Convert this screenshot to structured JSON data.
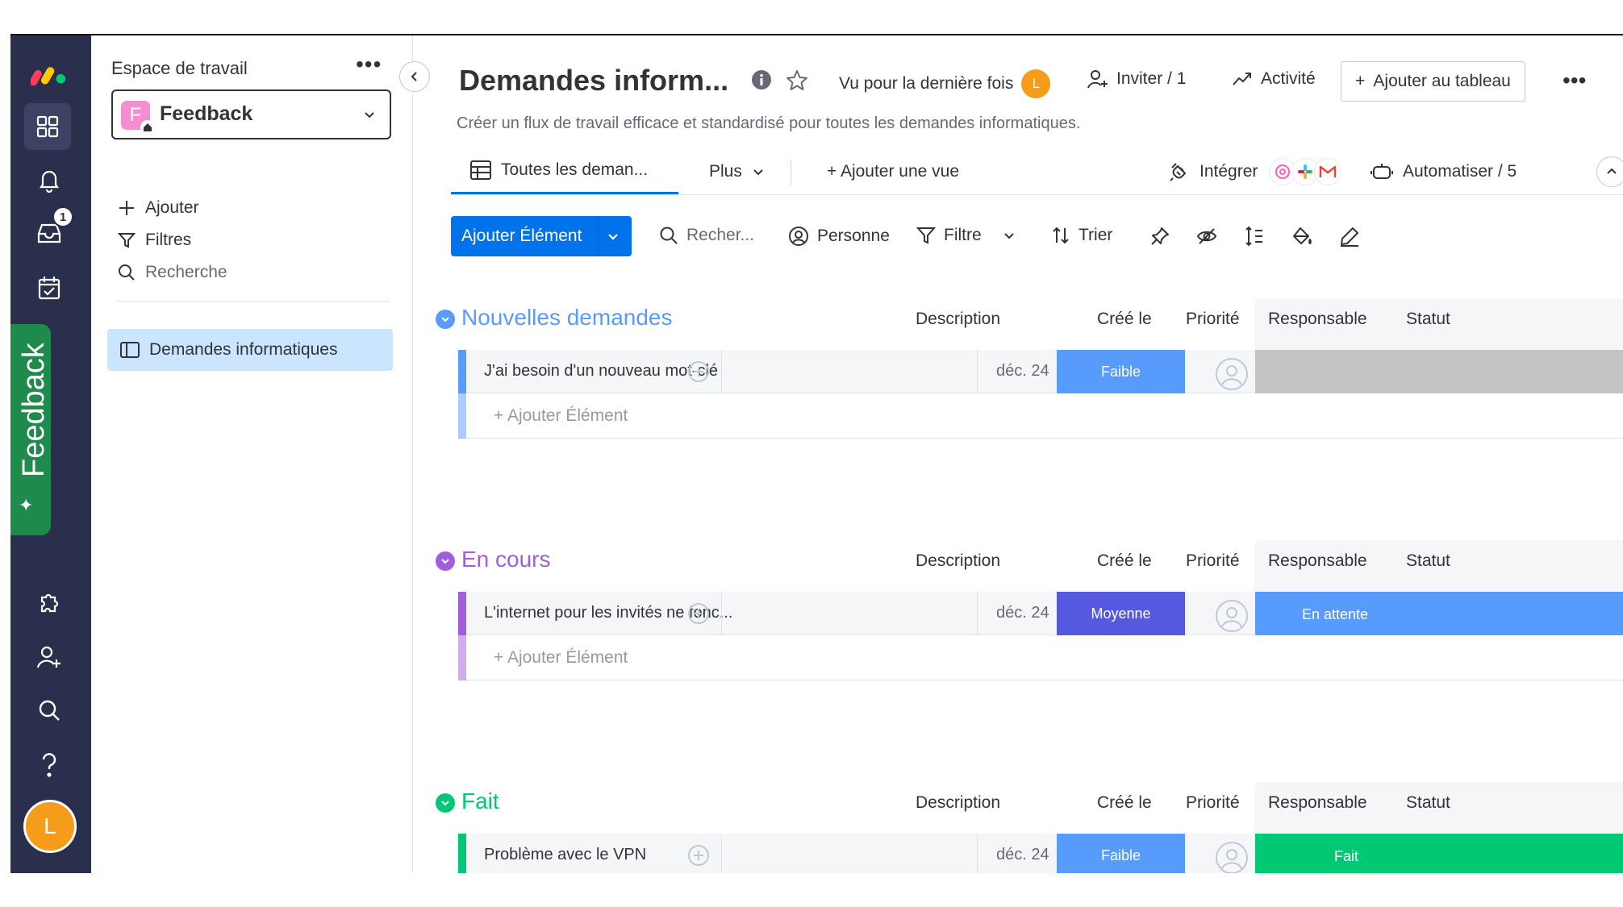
{
  "colors": {
    "rail": "#292f4c",
    "primary": "#0073ea",
    "feedback_tab": "#1e8a4c",
    "group_new": "#579bfc",
    "group_progress": "#a25ddc",
    "group_done": "#00c875",
    "prio_low": "#579bfc",
    "prio_medium": "#5559df",
    "status_empty": "#c4c4c4",
    "status_waiting": "#579bfc",
    "status_done": "#00c875",
    "avatar": "#f59c1b"
  },
  "rail": {
    "icons": [
      "monday-logo-icon",
      "grid-icon",
      "bell-icon",
      "inbox-icon",
      "calendar-check-icon",
      "puzzle-icon",
      "user-add-icon",
      "search-icon",
      "help-icon"
    ],
    "inbox_badge": "1",
    "feedback_label": "Feedback",
    "avatar_initial": "L"
  },
  "workspace": {
    "title": "Espace de travail",
    "more": "•••",
    "selected": "Feedback",
    "selected_initial": "F",
    "actions": {
      "add": "Ajouter",
      "filters": "Filtres",
      "search": "Recherche"
    },
    "boards": [
      "Demandes informatiques"
    ]
  },
  "header": {
    "title": "Demandes inform...",
    "last_seen": "Vu pour la dernière fois",
    "last_seen_avatar": "L",
    "invite": "Inviter / 1",
    "activity": "Activité",
    "add_to_board": "Ajouter au tableau",
    "more": "•••",
    "description": "Créer un flux de travail efficace et standardisé pour toutes les demandes informatiques."
  },
  "views": {
    "main_tab": "Toutes les deman...",
    "more": "Plus",
    "add_view": "+ Ajouter une vue",
    "integrate": "Intégrer",
    "automate": "Automatiser / 5"
  },
  "toolbar": {
    "add_item": "Ajouter Élément",
    "search_placeholder": "Recher...",
    "person": "Personne",
    "filter": "Filtre",
    "sort": "Trier"
  },
  "columns": {
    "description": "Description",
    "created": "Créé le",
    "priority": "Priorité",
    "owner": "Responsable",
    "status": "Statut"
  },
  "add_item_row": "+ Ajouter Élément",
  "groups": [
    {
      "title": "Nouvelles demandes",
      "color": "#579bfc",
      "item": {
        "name": "J'ai besoin d'un nouveau mot-clé",
        "date": "déc. 24",
        "priority": "Faible",
        "priority_color": "#579bfc",
        "status": "",
        "status_color": "#c4c4c4"
      }
    },
    {
      "title": "En cours",
      "color": "#a25ddc",
      "item": {
        "name": "L'internet pour les invités ne fonc...",
        "date": "déc. 24",
        "priority": "Moyenne",
        "priority_color": "#5559df",
        "status": "En attente",
        "status_color": "#579bfc"
      }
    },
    {
      "title": "Fait",
      "color": "#00c875",
      "item": {
        "name": "Problème avec le VPN",
        "date": "déc. 24",
        "priority": "Faible",
        "priority_color": "#579bfc",
        "status": "Fait",
        "status_color": "#00c875"
      }
    }
  ]
}
